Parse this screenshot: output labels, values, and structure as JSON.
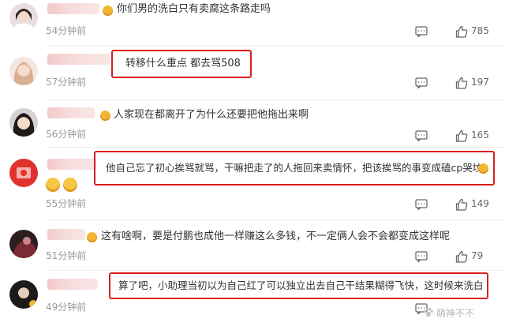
{
  "comments": [
    {
      "text": "你们男的洗白只有卖腐这条路走吗",
      "time": "54分钟前",
      "likes": "785",
      "highlighted": false
    },
    {
      "text": "转移什么重点 都去骂508",
      "time": "57分钟前",
      "likes": "197",
      "highlighted": true
    },
    {
      "text": "人家现在都离开了为什么还要把他拖出来啊",
      "time": "56分钟前",
      "likes": "165",
      "highlighted": false
    },
    {
      "text": "他自己忘了初心挨骂就骂，干嘛把走了的人拖回来卖情怀，把该挨骂的事变成磕cp哭坟",
      "time": "55分钟前",
      "likes": "149",
      "highlighted": true
    },
    {
      "text": "这有啥啊，要是付鹏也成他一样赚这么多钱，不一定俩人会不会都变成这样呢",
      "time": "51分钟前",
      "likes": "79",
      "highlighted": false
    },
    {
      "text": "算了吧，小助理当初以为自己红了可以独立出去自己干结果糊得飞快，这时候来洗白",
      "time": "49分钟前",
      "likes": "",
      "highlighted": true
    }
  ],
  "watermark": "萌神不不",
  "colors": {
    "highlight_border": "#d81e1e",
    "time_text": "#999999",
    "comment_text": "#333333",
    "username_blur": "#f3c9c9"
  },
  "icons": {
    "reply": "comment-bubble-icon",
    "like": "thumbs-up-icon"
  }
}
